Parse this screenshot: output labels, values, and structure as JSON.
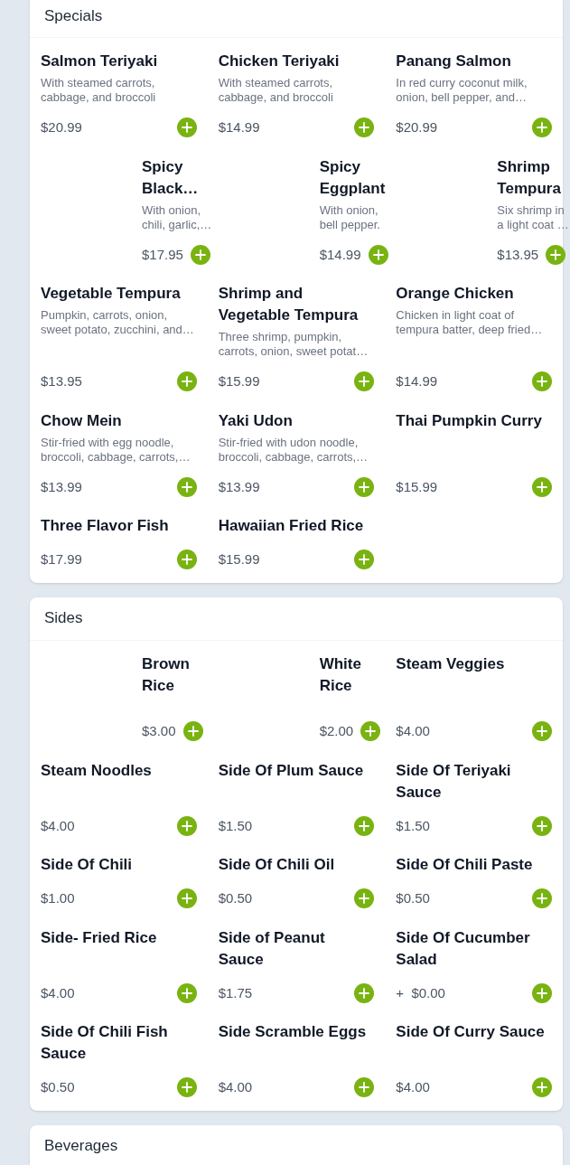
{
  "sections": [
    {
      "title": "Specials",
      "items": [
        {
          "kind": "plain",
          "name": "Salmon Teriyaki",
          "description": "With steamed carrots, cabbage, and broccoli",
          "price": "$20.99"
        },
        {
          "kind": "plain",
          "name": "Chicken Teriyaki",
          "description": "With steamed carrots, cabbage, and broccoli",
          "price": "$14.99"
        },
        {
          "kind": "plain",
          "name": "Panang Salmon",
          "description": "In red curry coconut milk, onion, bell pepper, and…",
          "price": "$20.99"
        },
        {
          "kind": "image",
          "name": "Spicy Black…",
          "description": "With onion, chili, garlic,…",
          "price": "$17.95"
        },
        {
          "kind": "image",
          "name": "Spicy Eggplant",
          "description": "With onion, bell pepper.",
          "price": "$14.99"
        },
        {
          "kind": "image",
          "name": "Shrimp Tempura",
          "description": "Six shrimp in a light coat …",
          "price": "$13.95"
        },
        {
          "kind": "plain",
          "name": "Vegetable Tempura",
          "description": "Pumpkin, carrots, onion, sweet potato, zucchini, and…",
          "price": "$13.95"
        },
        {
          "kind": "plain",
          "name": "Shrimp and Vegetable Tempura",
          "description": "Three shrimp, pumpkin, carrots, onion, sweet potat…",
          "price": "$15.99"
        },
        {
          "kind": "plain",
          "name": "Orange Chicken",
          "description": "Chicken in light coat of tempura batter, deep fried…",
          "price": "$14.99"
        },
        {
          "kind": "plain",
          "name": "Chow Mein",
          "description": "Stir-fried with egg noodle, broccoli, cabbage, carrots,…",
          "price": "$13.99"
        },
        {
          "kind": "plain",
          "name": "Yaki Udon",
          "description": "Stir-fried with udon noodle, broccoli, cabbage, carrots,…",
          "price": "$13.99"
        },
        {
          "kind": "plain",
          "name": "Thai Pumpkin Curry",
          "price": "$15.99"
        },
        {
          "kind": "plain",
          "name": "Three Flavor Fish",
          "price": "$17.99"
        },
        {
          "kind": "plain",
          "name": "Hawaiian Fried Rice",
          "price": "$15.99"
        }
      ]
    },
    {
      "title": "Sides",
      "items": [
        {
          "kind": "image",
          "name": "Brown Rice",
          "price": "$3.00"
        },
        {
          "kind": "image",
          "name": "White Rice",
          "price": "$2.00"
        },
        {
          "kind": "plain",
          "name": "Steam Veggies",
          "price": "$4.00"
        },
        {
          "kind": "plain",
          "name": "Steam Noodles",
          "price": "$4.00"
        },
        {
          "kind": "plain",
          "name": "Side Of Plum Sauce",
          "price": "$1.50"
        },
        {
          "kind": "plain",
          "name": "Side Of Teriyaki Sauce",
          "price": "$1.50"
        },
        {
          "kind": "plain",
          "name": "Side Of Chili",
          "price": "$1.00"
        },
        {
          "kind": "plain",
          "name": "Side Of Chili Oil",
          "price": "$0.50"
        },
        {
          "kind": "plain",
          "name": "Side Of Chili Paste",
          "price": "$0.50"
        },
        {
          "kind": "plain",
          "name": "Side- Fried Rice",
          "price": "$4.00"
        },
        {
          "kind": "plain",
          "name": "Side of Peanut Sauce",
          "price": "$1.75"
        },
        {
          "kind": "plain",
          "name": "Side Of Cucumber Salad",
          "price": "+  $0.00"
        },
        {
          "kind": "plain",
          "name": "Side Of Chili Fish Sauce",
          "price": "$0.50"
        },
        {
          "kind": "plain",
          "name": "Side Scramble Eggs",
          "price": "$4.00"
        },
        {
          "kind": "plain",
          "name": "Side Of Curry Sauce",
          "price": "$4.00"
        }
      ]
    },
    {
      "title": "Beverages"
    }
  ]
}
